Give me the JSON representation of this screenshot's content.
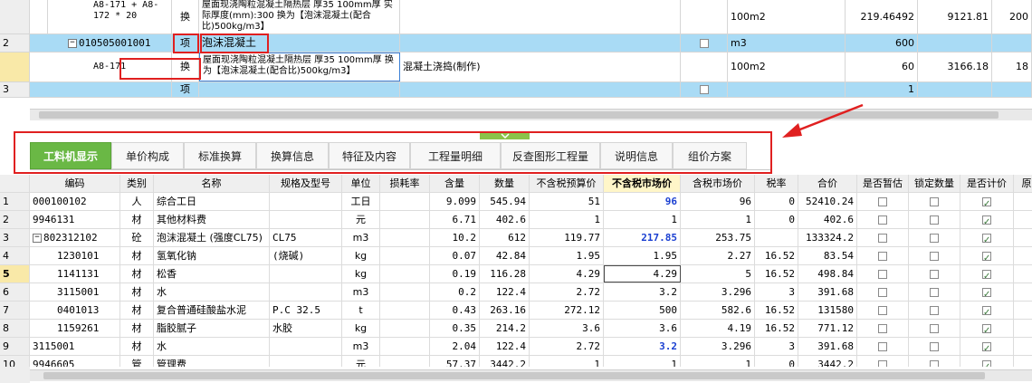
{
  "top_grid": {
    "rows": [
      {
        "num": "",
        "code": "A8-171 +\nA8-172 * 20",
        "type": "换",
        "name": "屋面现浇陶粒混凝土隔热层 厚35 100mm厚 实际厚度(mm):300 换为【泡沫混凝土(配合比)500kg/m3】",
        "feature": "",
        "unit": "100m2",
        "qty": "",
        "price": "219.46492",
        "total": "9121.81",
        "extra": "200"
      },
      {
        "num": "2",
        "code": "010505001001",
        "type": "项",
        "name": "泡沫混凝土",
        "feature": "",
        "unit": "m3",
        "qty": "600",
        "price": "",
        "total": "",
        "extra": ""
      },
      {
        "num": "",
        "code": "A8-171",
        "type": "换",
        "name": "屋面现浇陶粒混凝土隔热层 厚35 100mm厚 换为【泡沫混凝土(配合比)500kg/m3】",
        "feature": "混凝土浇捣(制作)",
        "unit": "100m2",
        "qty": "60",
        "price": "3166.18",
        "total": "",
        "extra": "18"
      },
      {
        "num": "3",
        "code": "",
        "type": "项",
        "name": "",
        "feature": "",
        "unit": "",
        "qty": "1",
        "price": "",
        "total": "",
        "extra": ""
      }
    ]
  },
  "tabs": [
    {
      "label": "工料机显示",
      "active": true
    },
    {
      "label": "单价构成"
    },
    {
      "label": "标准换算"
    },
    {
      "label": "换算信息"
    },
    {
      "label": "特征及内容"
    },
    {
      "label": "工程量明细"
    },
    {
      "label": "反查图形工程量"
    },
    {
      "label": "说明信息"
    },
    {
      "label": "组价方案"
    }
  ],
  "bottom_grid": {
    "headers": [
      "编码",
      "类别",
      "名称",
      "规格及型号",
      "单位",
      "损耗率",
      "含量",
      "数量",
      "不含税预算价",
      "不含税市场价",
      "含税市场价",
      "税率",
      "合价",
      "是否暂估",
      "锁定数量",
      "是否计价",
      "原始"
    ],
    "rows": [
      {
        "num": "1",
        "code": "000100102",
        "cat": "人",
        "name": "综合工日",
        "spec": "",
        "unit": "工日",
        "loss": "",
        "content": "9.099",
        "qty": "545.94",
        "budget": "51",
        "market": "96",
        "market_tax": "96",
        "tax": "0",
        "total": "52410.24",
        "est": false,
        "lock": false,
        "priced": true
      },
      {
        "num": "2",
        "code": "9946131",
        "cat": "材",
        "name": "其他材料费",
        "spec": "",
        "unit": "元",
        "loss": "",
        "content": "6.71",
        "qty": "402.6",
        "budget": "1",
        "market": "1",
        "market_tax": "1",
        "tax": "0",
        "total": "402.6",
        "est": false,
        "lock": false,
        "priced": true
      },
      {
        "num": "3",
        "code": "802312102",
        "cat": "砼",
        "name": "泡沫混凝土 (强度CL75)",
        "spec": "CL75",
        "unit": "m3",
        "loss": "",
        "content": "10.2",
        "qty": "612",
        "budget": "119.77",
        "market": "217.85",
        "market_tax": "253.75",
        "tax": "",
        "total": "133324.2",
        "est": false,
        "lock": false,
        "priced": true
      },
      {
        "num": "4",
        "code": "1230101",
        "cat": "材",
        "name": "氢氧化钠",
        "spec": "(烧碱)",
        "unit": "kg",
        "loss": "",
        "content": "0.07",
        "qty": "42.84",
        "budget": "1.95",
        "market": "1.95",
        "market_tax": "2.27",
        "tax": "16.52",
        "total": "83.54",
        "est": false,
        "lock": false,
        "priced": true
      },
      {
        "num": "5",
        "code": "1141131",
        "cat": "材",
        "name": "松香",
        "spec": "",
        "unit": "kg",
        "loss": "",
        "content": "0.19",
        "qty": "116.28",
        "budget": "4.29",
        "market": "4.29",
        "market_tax": "5",
        "tax": "16.52",
        "total": "498.84",
        "est": false,
        "lock": false,
        "priced": true
      },
      {
        "num": "6",
        "code": "3115001",
        "cat": "材",
        "name": "水",
        "spec": "",
        "unit": "m3",
        "loss": "",
        "content": "0.2",
        "qty": "122.4",
        "budget": "2.72",
        "market": "3.2",
        "market_tax": "3.296",
        "tax": "3",
        "total": "391.68",
        "est": false,
        "lock": false,
        "priced": true
      },
      {
        "num": "7",
        "code": "0401013",
        "cat": "材",
        "name": "复合普通硅酸盐水泥",
        "spec": "P.C 32.5",
        "unit": "t",
        "loss": "",
        "content": "0.43",
        "qty": "263.16",
        "budget": "272.12",
        "market": "500",
        "market_tax": "582.6",
        "tax": "16.52",
        "total": "131580",
        "est": false,
        "lock": false,
        "priced": true
      },
      {
        "num": "8",
        "code": "1159261",
        "cat": "材",
        "name": "脂胶腻子",
        "spec": "水胶",
        "unit": "kg",
        "loss": "",
        "content": "0.35",
        "qty": "214.2",
        "budget": "3.6",
        "market": "3.6",
        "market_tax": "4.19",
        "tax": "16.52",
        "total": "771.12",
        "est": false,
        "lock": false,
        "priced": true
      },
      {
        "num": "9",
        "code": "3115001",
        "cat": "材",
        "name": "水",
        "spec": "",
        "unit": "m3",
        "loss": "",
        "content": "2.04",
        "qty": "122.4",
        "budget": "2.72",
        "market": "3.2",
        "market_tax": "3.296",
        "tax": "3",
        "total": "391.68",
        "est": false,
        "lock": false,
        "priced": true
      },
      {
        "num": "10",
        "code": "9946605",
        "cat": "管",
        "name": "管理费",
        "spec": "",
        "unit": "元",
        "loss": "",
        "content": "57.37",
        "qty": "3442.2",
        "budget": "1",
        "market": "1",
        "market_tax": "1",
        "tax": "0",
        "total": "3442.2",
        "est": false,
        "lock": false,
        "priced": true
      }
    ]
  },
  "colors": {
    "accent_green": "#6ab845",
    "highlight_red": "#e02020",
    "row_blue": "#a9dbf5",
    "value_blue": "#1a3fd1"
  }
}
